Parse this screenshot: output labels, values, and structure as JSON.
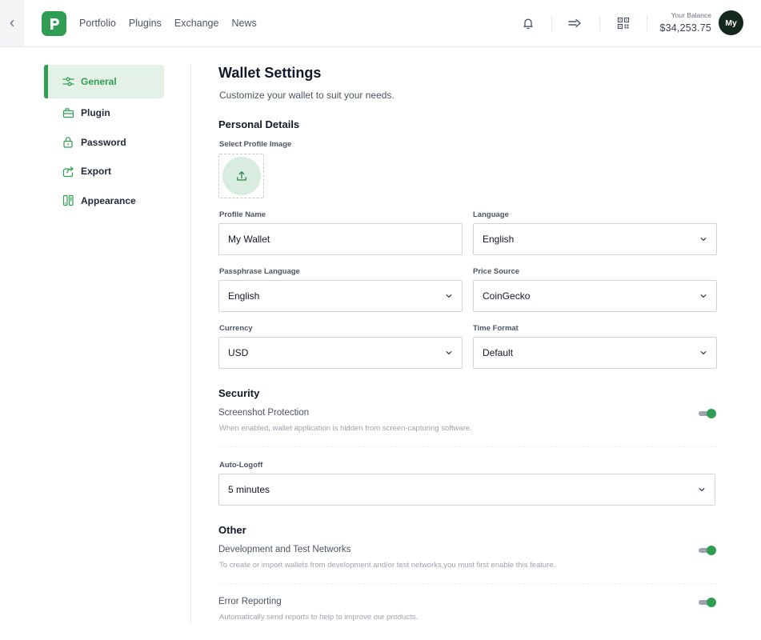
{
  "header": {
    "nav": [
      "Portfolio",
      "Plugins",
      "Exchange",
      "News"
    ],
    "balance_label": "Your Balance",
    "balance_value": "$34,253.75",
    "avatar_initials": "My"
  },
  "sidebar": {
    "items": [
      {
        "label": "General",
        "icon": "sliders-icon",
        "active": true
      },
      {
        "label": "Plugin",
        "icon": "plugin-icon",
        "active": false
      },
      {
        "label": "Password",
        "icon": "lock-icon",
        "active": false
      },
      {
        "label": "Export",
        "icon": "export-icon",
        "active": false
      },
      {
        "label": "Appearance",
        "icon": "appearance-icon",
        "active": false
      }
    ]
  },
  "main": {
    "title": "Wallet Settings",
    "subtitle": "Customize your wallet to suit your needs.",
    "personal": {
      "title": "Personal Details",
      "profile_image_label": "Select Profile Image",
      "profile_name_label": "Profile Name",
      "profile_name_value": "My Wallet",
      "language_label": "Language",
      "language_value": "English",
      "passphrase_label": "Passphrase Language",
      "passphrase_value": "English",
      "price_source_label": "Price Source",
      "price_source_value": "CoinGecko",
      "currency_label": "Currency",
      "currency_value": "USD",
      "time_format_label": "Time Format",
      "time_format_value": "Default"
    },
    "security": {
      "title": "Security",
      "screenshot_title": "Screenshot Protection",
      "screenshot_desc": "When enabled, wallet application is hidden from screen-capturing software.",
      "screenshot_enabled": true,
      "autologoff_label": "Auto-Logoff",
      "autologoff_value": "5 minutes"
    },
    "other": {
      "title": "Other",
      "devnet_title": "Development and Test Networks",
      "devnet_desc": "To create or import wallets from development and/or test networks,you must first enable this feature.",
      "devnet_enabled": true,
      "error_title": "Error Reporting",
      "error_desc": "Automatically send reports to help to improve our products.",
      "error_enabled": true
    }
  },
  "colors": {
    "accent": "#2f9e52",
    "accent_light": "#e3f1e7",
    "avatar_bg": "#14281c"
  }
}
